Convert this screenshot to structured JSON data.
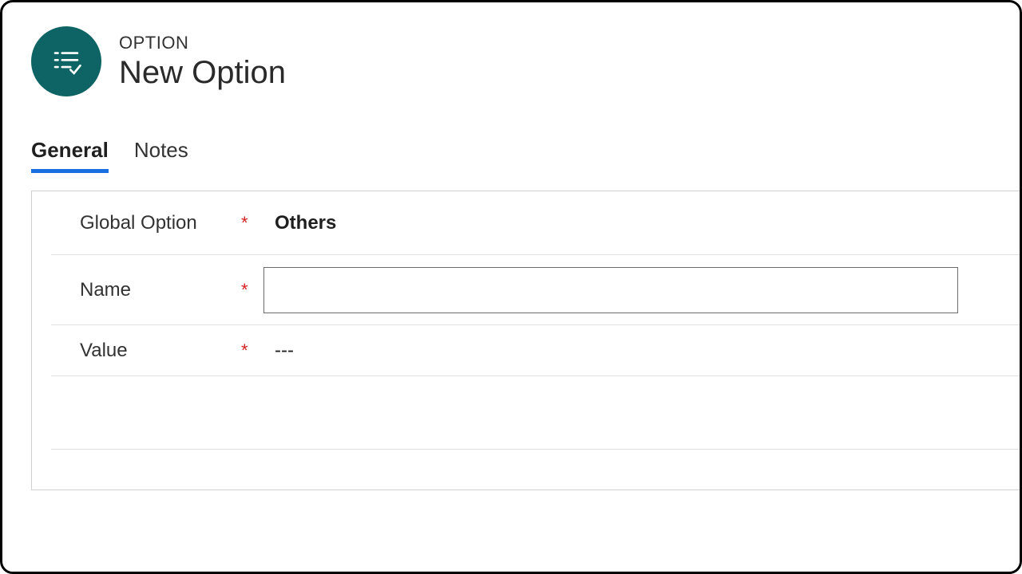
{
  "header": {
    "entity_type": "OPTION",
    "title": "New Option"
  },
  "tabs": [
    {
      "label": "General",
      "active": true
    },
    {
      "label": "Notes",
      "active": false
    }
  ],
  "form": {
    "global_option": {
      "label": "Global Option",
      "required_marker": "*",
      "value": "Others"
    },
    "name": {
      "label": "Name",
      "required_marker": "*",
      "value": ""
    },
    "value_field": {
      "label": "Value",
      "required_marker": "*",
      "value": "---"
    }
  }
}
